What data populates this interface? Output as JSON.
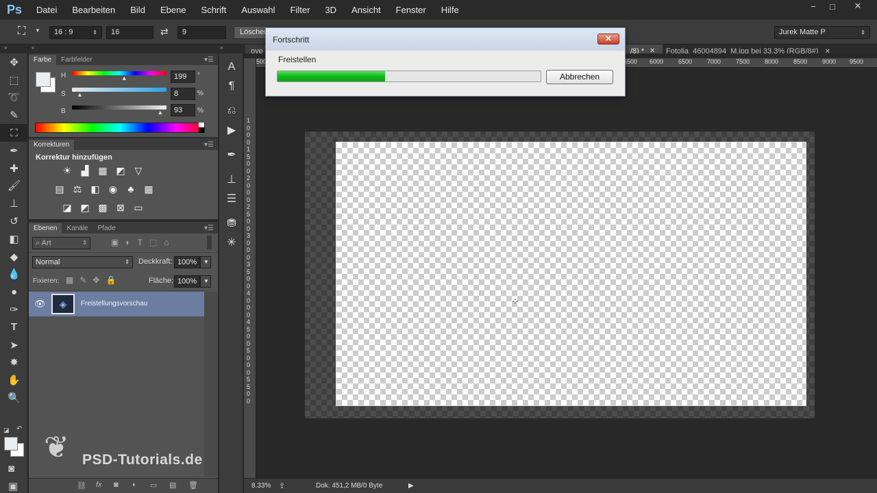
{
  "app": {
    "logo": "Ps"
  },
  "menu": [
    "Datei",
    "Bearbeiten",
    "Bild",
    "Ebene",
    "Schrift",
    "Auswahl",
    "Filter",
    "3D",
    "Ansicht",
    "Fenster",
    "Hilfe"
  ],
  "window_controls": {
    "minimize": "−",
    "restore": "□",
    "close": "✕"
  },
  "options": {
    "ratio": "16 : 9",
    "width": "16",
    "height": "9",
    "clear_button": "Löschen",
    "workspace": "Jurek Matte P"
  },
  "color_panel": {
    "tabs": [
      "Farbe",
      "Farbfelder"
    ],
    "h_label": "H",
    "h_value": "199",
    "h_unit": "°",
    "s_label": "S",
    "s_value": "8",
    "s_unit": "%",
    "b_label": "B",
    "b_value": "93",
    "b_unit": "%",
    "h_level": 0.55,
    "s_level": 0.08,
    "b_level": 0.93
  },
  "adjustments_panel": {
    "tab": "Korrekturen",
    "heading": "Korrektur hinzufügen"
  },
  "layers_panel": {
    "tabs": [
      "Ebenen",
      "Kanäle",
      "Pfade"
    ],
    "filter_placeholder": "Art",
    "blend_mode": "Normal",
    "opacity_label": "Deckkraft:",
    "opacity_value": "100%",
    "lock_label": "Fixieren:",
    "fill_label": "Fläche:",
    "fill_value": "100%",
    "layer_name": "Freistellungsvorschau"
  },
  "watermark": "PSD-Tutorials.de",
  "document": {
    "tab_partial_left": "ove",
    "tab_active_suffix": "/8) *",
    "tab_second": "Fotolia_46004894_M.jpg bei 33.3% (RGB/8#)",
    "ruler_h": [
      "500",
      "5500",
      "6000",
      "6500",
      "7000",
      "7500",
      "8000",
      "8500",
      "9000",
      "9500"
    ],
    "ruler_v": [
      "1",
      "0",
      "0",
      "0",
      "1",
      "5",
      "0",
      "0",
      "2",
      "0",
      "0",
      "0",
      "2",
      "5",
      "0",
      "0",
      "3",
      "0",
      "0",
      "0",
      "3",
      "5",
      "0",
      "0",
      "4",
      "0",
      "0",
      "0",
      "4",
      "5",
      "0",
      "0",
      "5",
      "0",
      "0",
      "0",
      "5",
      "5",
      "0",
      "0"
    ],
    "zoom": "8.33%",
    "doc_info": "Dok: 451,2 MB/0 Byte"
  },
  "dialog": {
    "title": "Fortschritt",
    "message": "Freistellen",
    "cancel": "Abbrechen",
    "progress": 0.41
  }
}
